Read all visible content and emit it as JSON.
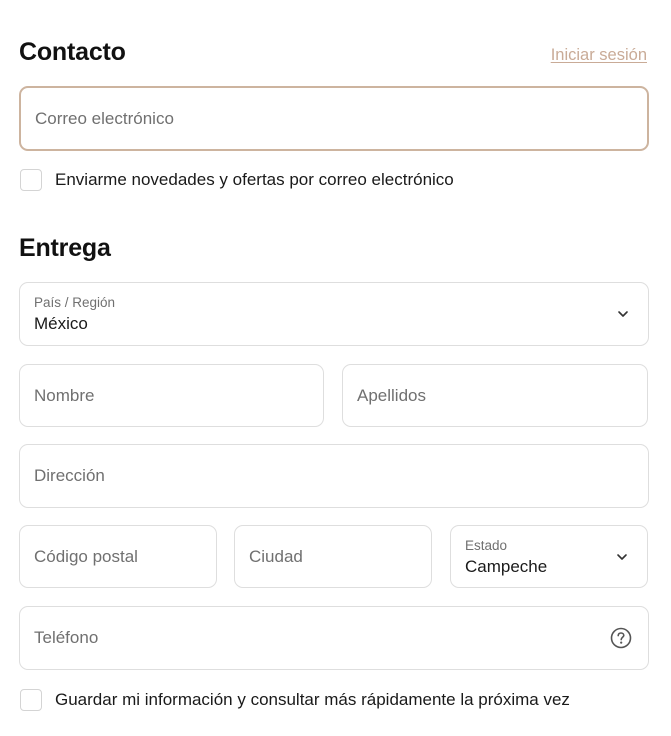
{
  "contact": {
    "title": "Contacto",
    "login_link": "Iniciar sesión",
    "email_placeholder": "Correo electrónico",
    "newsletter_label": "Enviarme novedades y ofertas por correo electrónico"
  },
  "delivery": {
    "title": "Entrega",
    "country": {
      "label": "País / Región",
      "value": "México"
    },
    "first_name_placeholder": "Nombre",
    "last_name_placeholder": "Apellidos",
    "address_placeholder": "Dirección",
    "postal_code_placeholder": "Código postal",
    "city_placeholder": "Ciudad",
    "state": {
      "label": "Estado",
      "value": "Campeche"
    },
    "phone_placeholder": "Teléfono",
    "save_info_label": "Guardar mi información y consultar más rápidamente la próxima vez"
  },
  "colors": {
    "accent_link": "#c9ab97",
    "focus_border": "#cdb49f",
    "field_border": "#dedede"
  },
  "icons": {
    "select": "chevron-down-icon",
    "phone_help": "question-circle-icon"
  }
}
